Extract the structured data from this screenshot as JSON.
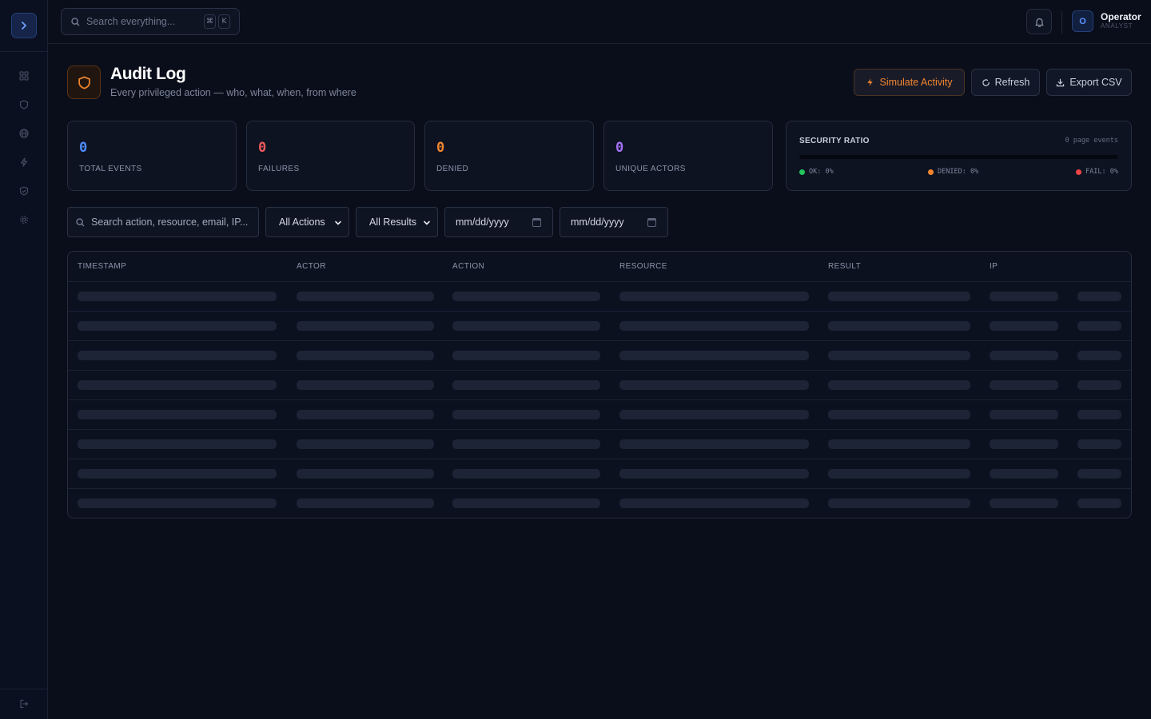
{
  "topbar": {
    "search_placeholder": "Search everything...",
    "kbd": [
      "⌘",
      "K"
    ],
    "user": {
      "initial": "O",
      "name": "Operator",
      "role": "ANALYST"
    }
  },
  "sidebar": {
    "icons": [
      "grid-icon",
      "shield-icon",
      "globe-icon",
      "bolt-icon",
      "shield-check-icon",
      "gear-icon"
    ],
    "footer_icon": "logout-icon"
  },
  "page": {
    "title": "Audit Log",
    "subtitle": "Every privileged action — who, what, when, from where"
  },
  "actions": {
    "simulate": "Simulate Activity",
    "refresh": "Refresh",
    "export": "Export CSV"
  },
  "stats": [
    {
      "value": "0",
      "label": "TOTAL EVENTS",
      "color": "#4f8cff"
    },
    {
      "value": "0",
      "label": "FAILURES",
      "color": "#f05a5a"
    },
    {
      "value": "0",
      "label": "DENIED",
      "color": "#f2862e"
    },
    {
      "value": "0",
      "label": "UNIQUE ACTORS",
      "color": "#a472f5"
    }
  ],
  "ratio": {
    "title": "SECURITY RATIO",
    "caption": "0 page events",
    "ok_fraction": 0,
    "legend": [
      {
        "label": "OK: 0%",
        "color": "#22c55e"
      },
      {
        "label": "DENIED: 0%",
        "color": "#f2862e"
      },
      {
        "label": "FAIL: 0%",
        "color": "#ef4444"
      }
    ]
  },
  "filters": {
    "search_placeholder": "Search action, resource, email, IP...",
    "action_selected": "All Actions",
    "result_selected": "All Results",
    "date_from": "mm/dd/yyyy",
    "date_to": "mm/dd/yyyy"
  },
  "table": {
    "columns": [
      "TIMESTAMP",
      "ACTOR",
      "ACTION",
      "RESOURCE",
      "RESULT",
      "IP"
    ],
    "loading_rows": 8
  }
}
